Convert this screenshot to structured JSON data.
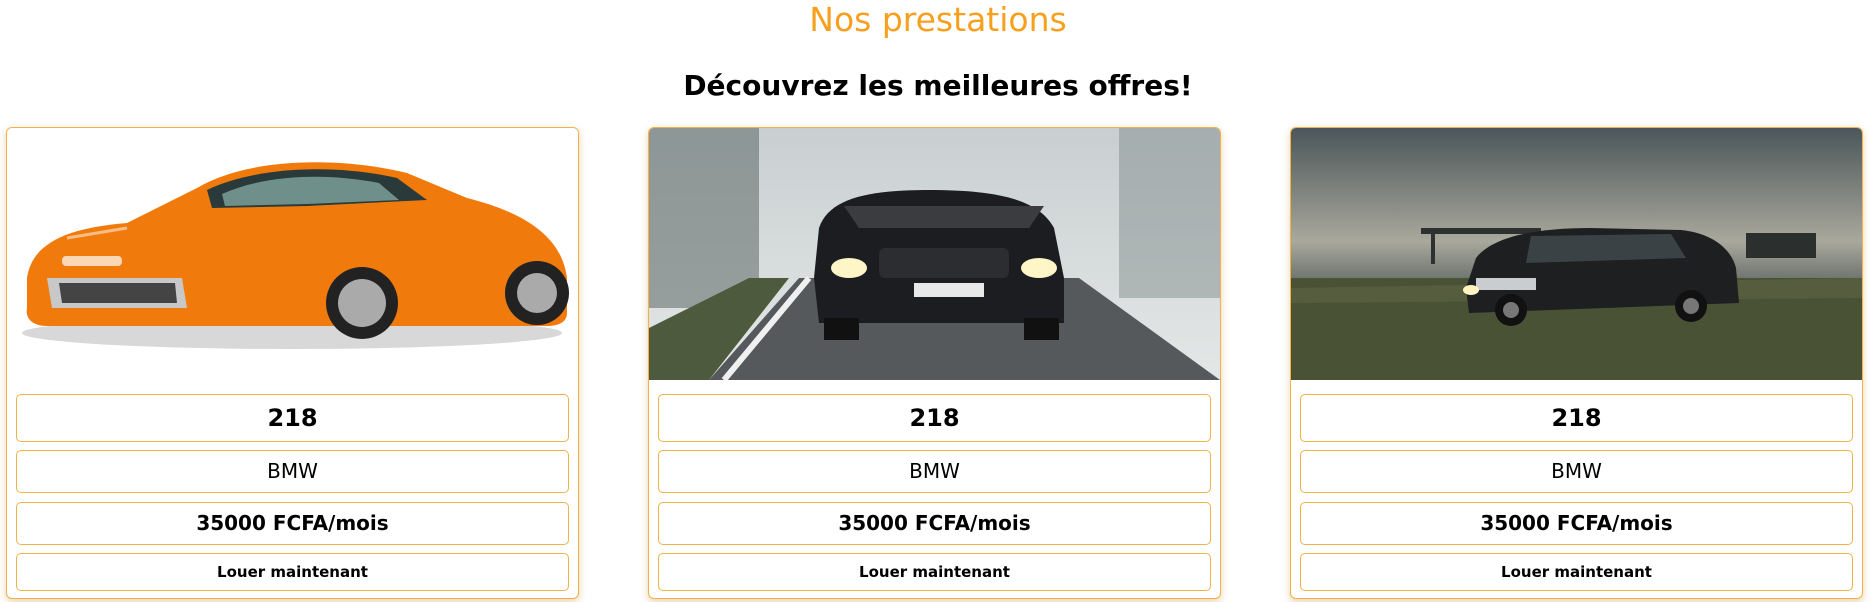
{
  "header": {
    "title": "Nos prestations",
    "subtitle": "Découvrez les meilleures offres!"
  },
  "offers": [
    {
      "image": "orange-sports-coupe",
      "model": "218",
      "brand": "BMW",
      "price": "35000 FCFA/mois",
      "cta": "Louer maintenant"
    },
    {
      "image": "dark-suv-on-foggy-road",
      "model": "218",
      "brand": "BMW",
      "price": "35000 FCFA/mois",
      "cta": "Louer maintenant"
    },
    {
      "image": "black-suv-in-field",
      "model": "218",
      "brand": "BMW",
      "price": "35000 FCFA/mois",
      "cta": "Louer maintenant"
    }
  ],
  "colors": {
    "accent": "#f7a01d",
    "border": "#f2b24a"
  }
}
